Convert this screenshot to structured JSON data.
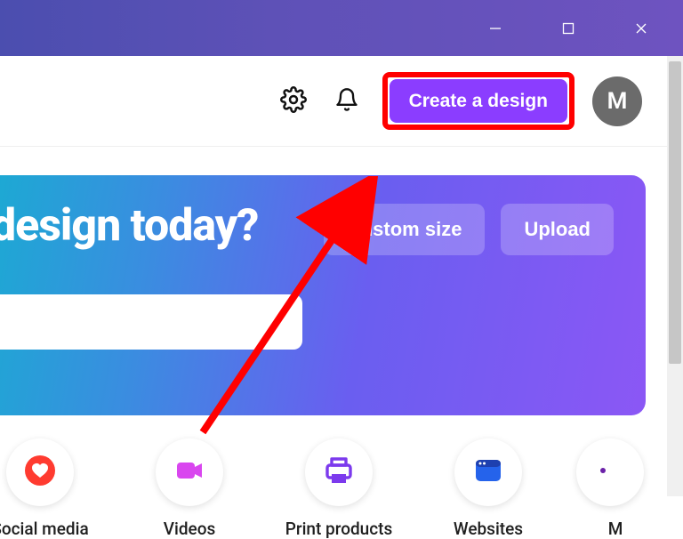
{
  "header": {
    "create_label": "Create a design",
    "avatar_initial": "M"
  },
  "hero": {
    "heading": "design today?",
    "custom_size_label": "Custom size",
    "upload_label": "Upload"
  },
  "categories": [
    {
      "label": "Social media",
      "icon": "heart"
    },
    {
      "label": "Videos",
      "icon": "video"
    },
    {
      "label": "Print products",
      "icon": "printer"
    },
    {
      "label": "Websites",
      "icon": "browser"
    },
    {
      "label": "M",
      "icon": "more"
    }
  ]
}
